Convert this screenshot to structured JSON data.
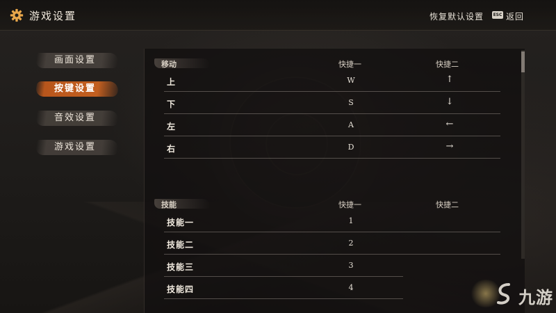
{
  "header": {
    "title": "游戏设置",
    "restore_label": "恢复默认设置",
    "esc_key": "ESC",
    "back_label": "返回",
    "icon": "gear-icon"
  },
  "menu": {
    "items": [
      {
        "label": "画面设置",
        "active": false
      },
      {
        "label": "按键设置",
        "active": true
      },
      {
        "label": "音效设置",
        "active": false
      },
      {
        "label": "游戏设置",
        "active": false
      }
    ]
  },
  "sections": [
    {
      "category": "移动",
      "col1": "快捷一",
      "col2": "快捷二",
      "rows": [
        {
          "name": "上",
          "key1": "W",
          "key2": "↑"
        },
        {
          "name": "下",
          "key1": "S",
          "key2": "↓"
        },
        {
          "name": "左",
          "key1": "A",
          "key2": "←"
        },
        {
          "name": "右",
          "key1": "D",
          "key2": "→"
        }
      ]
    },
    {
      "category": "技能",
      "col1": "快捷一",
      "col2": "快捷二",
      "rows": [
        {
          "name": "技能一",
          "key1": "1",
          "key2": ""
        },
        {
          "name": "技能二",
          "key1": "2",
          "key2": ""
        },
        {
          "name": "技能三",
          "key1": "3",
          "key2": ""
        },
        {
          "name": "技能四",
          "key1": "4",
          "key2": ""
        }
      ]
    }
  ],
  "watermark": {
    "text": "九游"
  },
  "colors": {
    "accent": "#c25f20",
    "gear": "#e8a64a"
  }
}
